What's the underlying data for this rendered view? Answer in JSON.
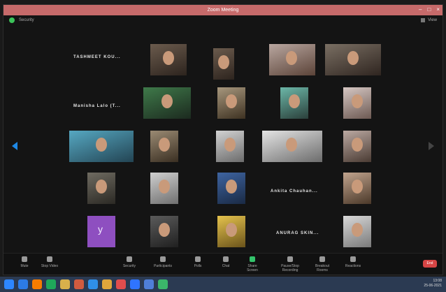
{
  "window": {
    "title": "Zoom Meeting"
  },
  "topbar": {
    "security_label": "Security",
    "view_label": "View"
  },
  "participants_named": [
    {
      "text": "TASHMEET KOU..."
    },
    {
      "text": "Manisha Lalo (T..."
    },
    {
      "text": "Ankita Chauhan..."
    },
    {
      "text": "ANURAG SKIN..."
    }
  ],
  "toolbar": {
    "items": [
      "Mute",
      "Stop Video",
      "Security",
      "Participants",
      "Polls",
      "Chat",
      "Share Screen",
      "Pause/Stop Recording",
      "Breakout Rooms",
      "Reactions"
    ],
    "end_label": "End"
  },
  "taskbar": {
    "time": "13:08",
    "date": "25-06-2021"
  }
}
